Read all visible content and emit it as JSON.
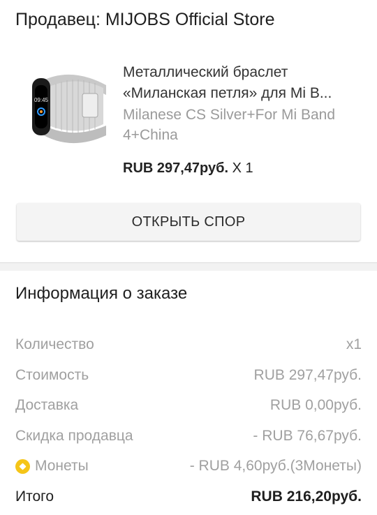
{
  "seller": {
    "text": "Продавец: MIJOBS Official Store"
  },
  "product": {
    "image_icon": "milanese-loop-band-image",
    "title_line1": "Металлический браслет",
    "title_line2": "«Миланская петля» для Mi B...",
    "variant_line1": "Milanese CS Silver+For Mi Band",
    "variant_line2": "4+China",
    "price": "RUB 297,47руб.",
    "quantity": "X 1"
  },
  "dispute_button": {
    "label": "ОТКРЫТЬ СПОР"
  },
  "order_info": {
    "title": "Информация о заказе",
    "rows": [
      {
        "label": "Количество",
        "value": "x1"
      },
      {
        "label": "Стоимость",
        "value": "RUB 297,47руб."
      },
      {
        "label": "Доставка",
        "value": "RUB 0,00руб."
      },
      {
        "label": "Скидка продавца",
        "value": "- RUB 76,67руб."
      },
      {
        "label": "Монеты",
        "value": "- RUB 4,60руб.(3Монеты)",
        "icon": "coin-icon",
        "icon_color": "#f5c518"
      }
    ],
    "total": {
      "label": "Итого",
      "value": "RUB 216,20руб."
    }
  }
}
